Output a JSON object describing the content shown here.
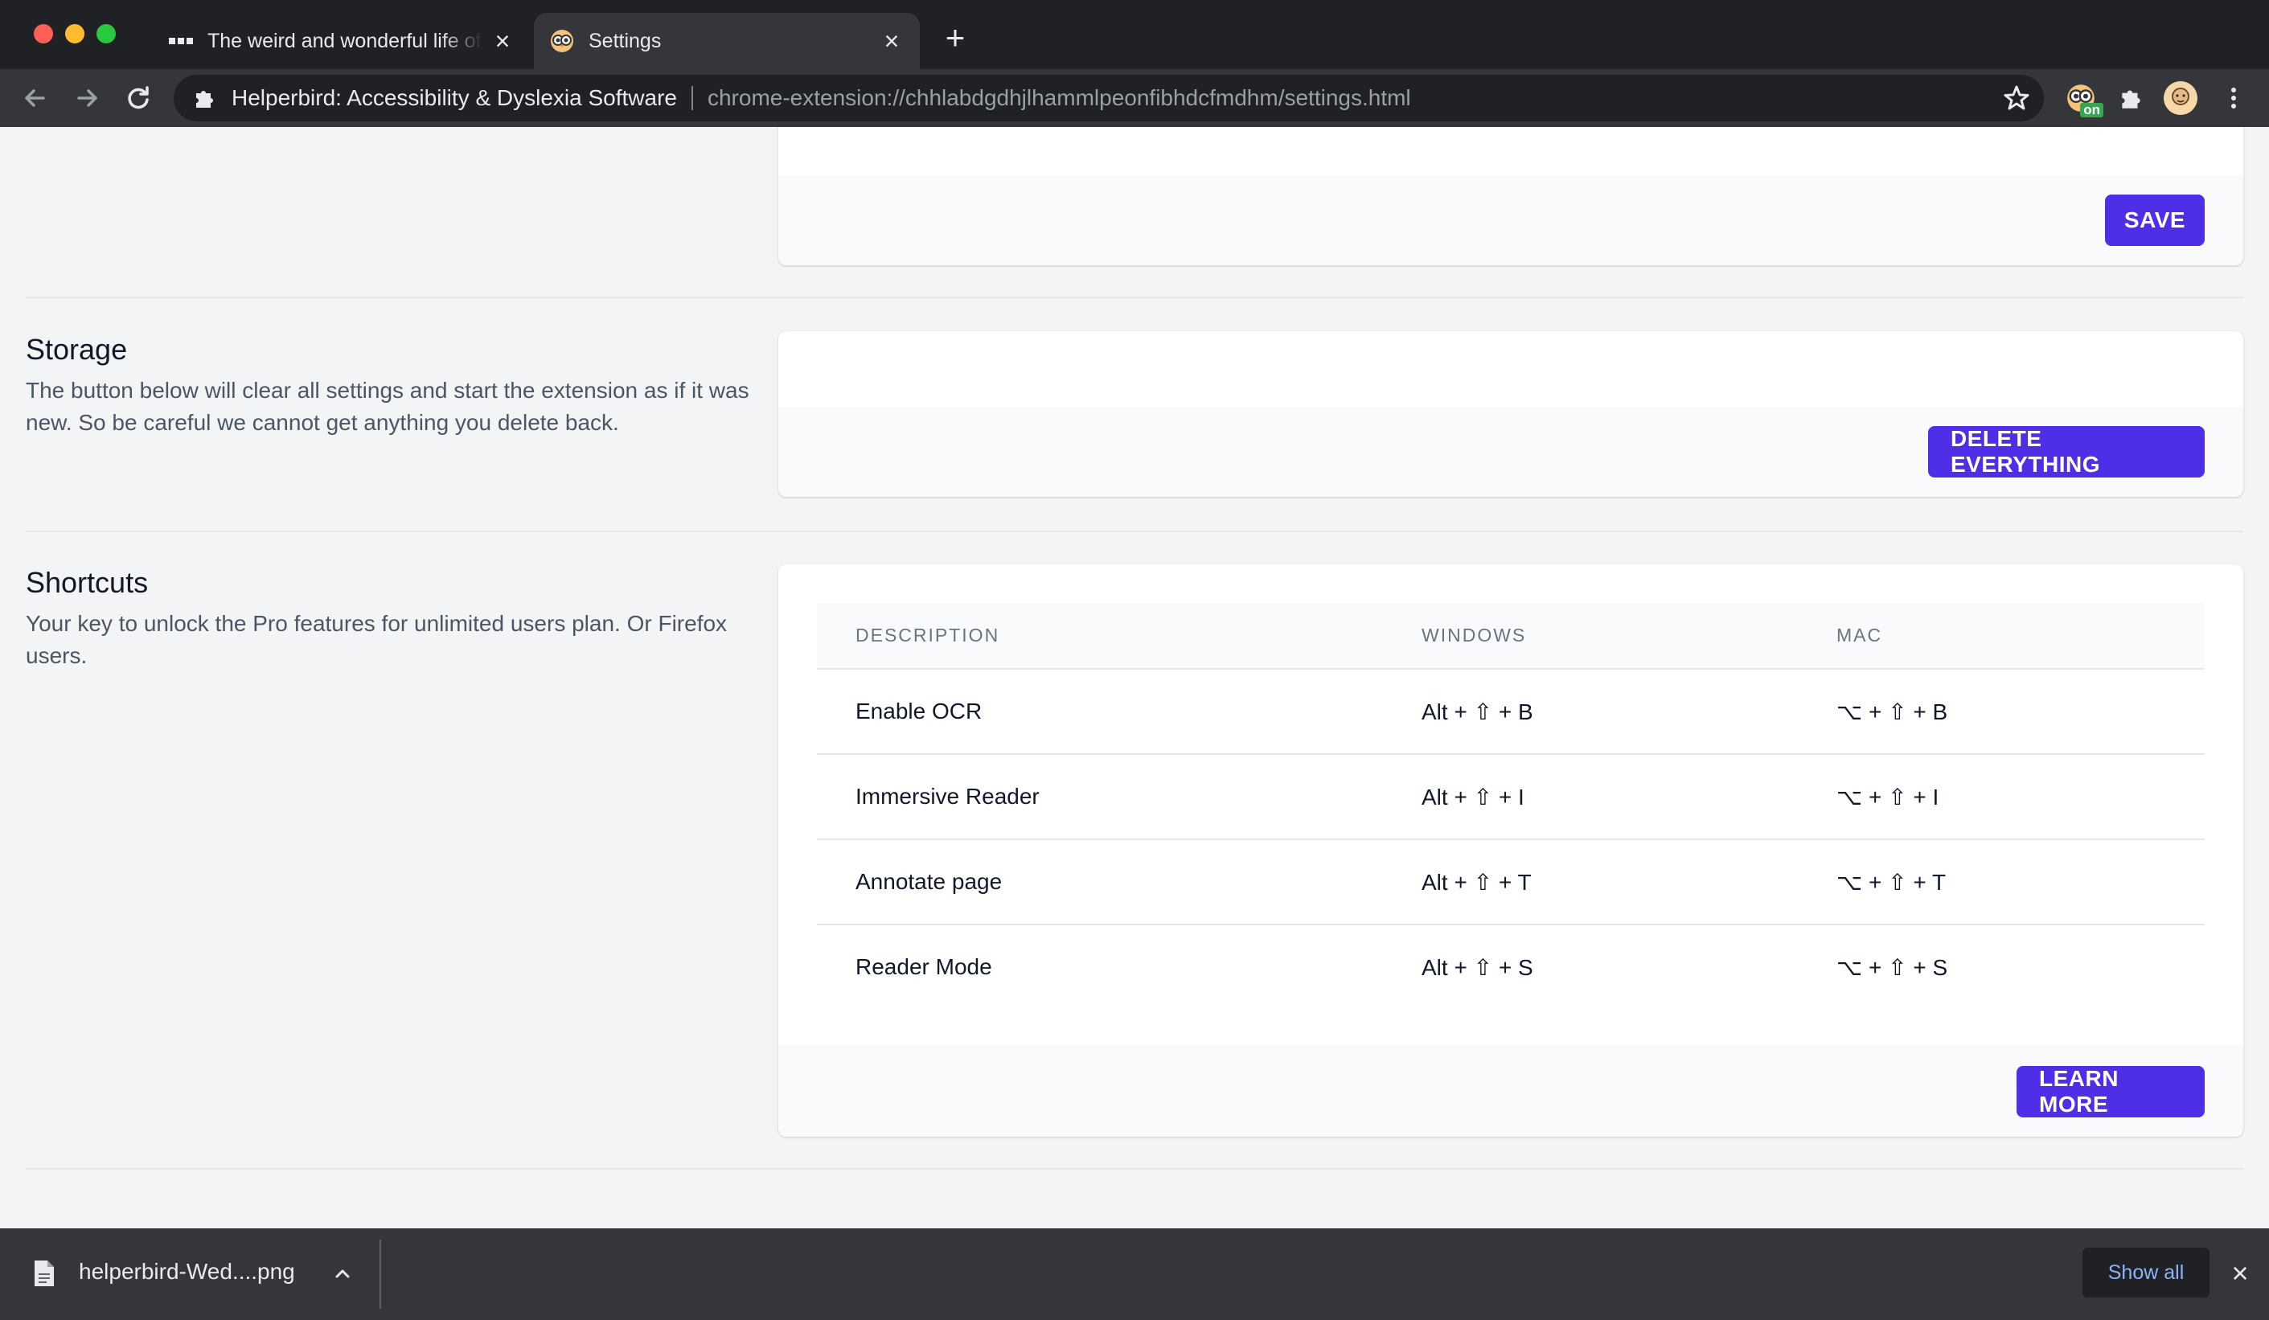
{
  "browser": {
    "tabs": [
      {
        "title": "The weird and wonderful life of",
        "active": false,
        "favicon": "bbc-icon"
      },
      {
        "title": "Settings",
        "active": true,
        "favicon": "helperbird-owl-icon"
      }
    ],
    "omnibox": {
      "site_name": "Helperbird: Accessibility & Dyslexia Software",
      "url": "chrome-extension://chhlabdgdhjlhammlpeonfibhdcfmdhm/settings.html"
    },
    "extension_badge": "on"
  },
  "sections": {
    "top_card": {
      "save_label": "SAVE"
    },
    "storage": {
      "title": "Storage",
      "description": "The button below will clear all settings and start the extension as if it was new. So be careful we cannot get anything you delete back.",
      "button_label": "DELETE EVERYTHING"
    },
    "shortcuts": {
      "title": "Shortcuts",
      "description": "Your key to unlock the Pro features for unlimited users plan. Or Firefox users.",
      "columns": [
        "DESCRIPTION",
        "WINDOWS",
        "MAC"
      ],
      "rows": [
        {
          "description": "Enable OCR",
          "windows": "Alt + ⇧ + B",
          "mac": "⌥ + ⇧ + B"
        },
        {
          "description": "Immersive Reader",
          "windows": "Alt + ⇧ + I",
          "mac": "⌥ + ⇧ + I"
        },
        {
          "description": "Annotate page",
          "windows": "Alt + ⇧ + T",
          "mac": "⌥ + ⇧ + T"
        },
        {
          "description": "Reader Mode",
          "windows": "Alt + ⇧ + S",
          "mac": "⌥ + ⇧ + S"
        }
      ],
      "button_label": "LEARN MORE"
    }
  },
  "downloads": {
    "file_name": "helperbird-Wed....png",
    "show_all_label": "Show all"
  },
  "colors": {
    "accent": "#4f2ee8",
    "page_bg": "#f3f4f6",
    "chrome_dark": "#202124",
    "chrome_mid": "#35363a"
  }
}
